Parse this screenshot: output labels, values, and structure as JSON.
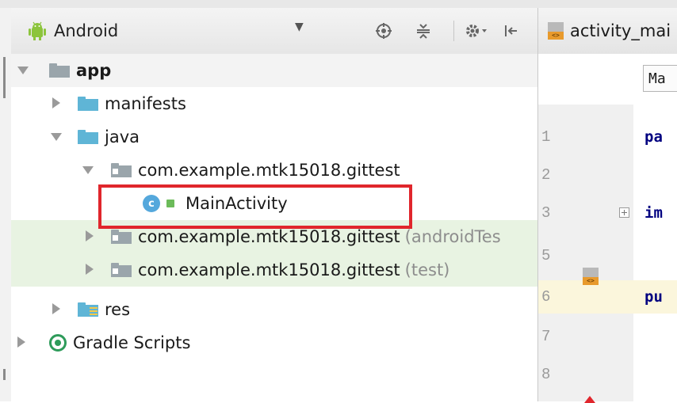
{
  "colors": {
    "selection_highlight": "#e8f3e2",
    "annotation_box": "#e0262c",
    "folder_blue": "#5fb5d6",
    "android_green": "#8cc43c",
    "keyword_navy": "#000080"
  },
  "project_panel": {
    "view_label": "Android",
    "toolbar_icons": [
      "sync-target-icon",
      "collapse-all-icon",
      "settings-gear-icon",
      "hide-panel-icon"
    ],
    "tree": [
      {
        "label": "app",
        "icon": "module-folder-icon",
        "expanded": true
      },
      {
        "label": "manifests",
        "icon": "folder-icon",
        "expanded": false
      },
      {
        "label": "java",
        "icon": "folder-icon",
        "expanded": true
      },
      {
        "label": "com.example.mtk15018.gittest",
        "icon": "package-icon",
        "expanded": true
      },
      {
        "label": "MainActivity",
        "icon": "class-icon"
      },
      {
        "label": "com.example.mtk15018.gittest",
        "suffix": "(androidTes",
        "icon": "package-icon",
        "expanded": false
      },
      {
        "label": "com.example.mtk15018.gittest",
        "suffix": "(test)",
        "icon": "package-icon",
        "expanded": false
      },
      {
        "label": "res",
        "icon": "res-folder-icon",
        "expanded": false
      },
      {
        "label": "Gradle Scripts",
        "icon": "gradle-icon",
        "expanded": false
      }
    ],
    "class_icon_letter": "c"
  },
  "editor": {
    "tab_label": "activity_mai",
    "breadcrumb": "Ma",
    "xml_icon_label": "<>",
    "line_numbers": [
      "1",
      "2",
      "3",
      "5",
      "6",
      "7",
      "8"
    ],
    "code_snippets": [
      "pa",
      "im",
      "pu"
    ]
  }
}
